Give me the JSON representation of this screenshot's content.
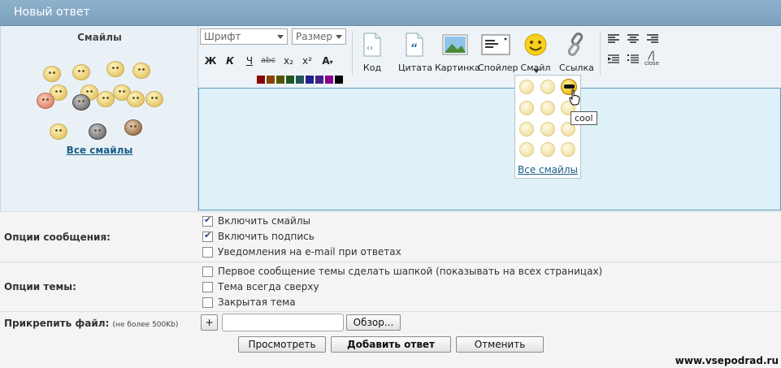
{
  "header": {
    "title": "Новый ответ"
  },
  "smilies_panel": {
    "title": "Смайлы",
    "all_link": "Все смайлы"
  },
  "toolbar": {
    "font_select": "Шрифт",
    "size_select": "Размер",
    "format_buttons": [
      {
        "label": "Ж",
        "icon": "bold-icon"
      },
      {
        "label": "К",
        "icon": "italic-icon"
      },
      {
        "label": "Ч",
        "icon": "underline-icon"
      },
      {
        "label": "abc",
        "icon": "strikethrough-icon"
      },
      {
        "label": "x₂",
        "icon": "subscript-icon"
      },
      {
        "label": "x²",
        "icon": "superscript-icon"
      },
      {
        "label": "A",
        "icon": "font-color-icon"
      }
    ],
    "buttons": [
      {
        "label": "Код",
        "icon": "code-icon"
      },
      {
        "label": "Цитата",
        "icon": "quote-icon"
      },
      {
        "label": "Картинка",
        "icon": "image-icon"
      },
      {
        "label": "Спойлер",
        "icon": "spoiler-icon"
      },
      {
        "label": "Смайл",
        "icon": "smiley-icon"
      },
      {
        "label": "Ссылка",
        "icon": "link-icon"
      }
    ],
    "close_label": "close",
    "palette_colors": [
      [
        "#880000",
        "#884400",
        "#555500",
        "#225522",
        "#225555",
        "#222288",
        "#442288",
        "#880088",
        "#000000"
      ],
      [
        "#cc0000",
        "#cc6600",
        "#888800",
        "#338833",
        "#338888",
        "#3355cc",
        "#6633cc",
        "#cc33cc",
        "#555555"
      ],
      [
        "#ff3300",
        "#ff9900",
        "#bbbb00",
        "#44aa44",
        "#44aaaa",
        "#4488ee",
        "#8844ee",
        "#ee44ee",
        "#999999"
      ],
      [
        "#ff6666",
        "#ffcc33",
        "#eeee22",
        "#66dd66",
        "#66dddd",
        "#66aaff",
        "#aa77ff",
        "#ff77ff",
        "#cccccc"
      ],
      [
        "#ffccbb",
        "#ffeecc",
        "#ffffcc",
        "#ccffcc",
        "#ccffff",
        "#cce0ff",
        "#e0ccff",
        "#ffccff",
        "#ffffff"
      ]
    ]
  },
  "smiley_popup": {
    "all_link": "Все смайлы",
    "tooltip": "cool"
  },
  "options": {
    "message_label": "Опции сообщения:",
    "message_options": [
      {
        "label": "Включить смайлы",
        "checked": true
      },
      {
        "label": "Включить подпись",
        "checked": true
      },
      {
        "label": "Уведомления на e-mail при ответах",
        "checked": false
      }
    ],
    "topic_label": "Опции темы:",
    "topic_options": [
      {
        "label": "Первое сообщение темы сделать шапкой (показывать на всех страницах)",
        "checked": false
      },
      {
        "label": "Тема всегда сверху",
        "checked": false
      },
      {
        "label": "Закрытая тема",
        "checked": false
      }
    ]
  },
  "attach": {
    "label": "Прикрепить файл:",
    "note": "(не более 500Kb)",
    "add_button": "+",
    "browse_button": "Обзор..."
  },
  "actions": {
    "preview": "Просмотреть",
    "submit": "Добавить ответ",
    "cancel": "Отменить"
  },
  "watermark": "www.vsepodrad.ru"
}
